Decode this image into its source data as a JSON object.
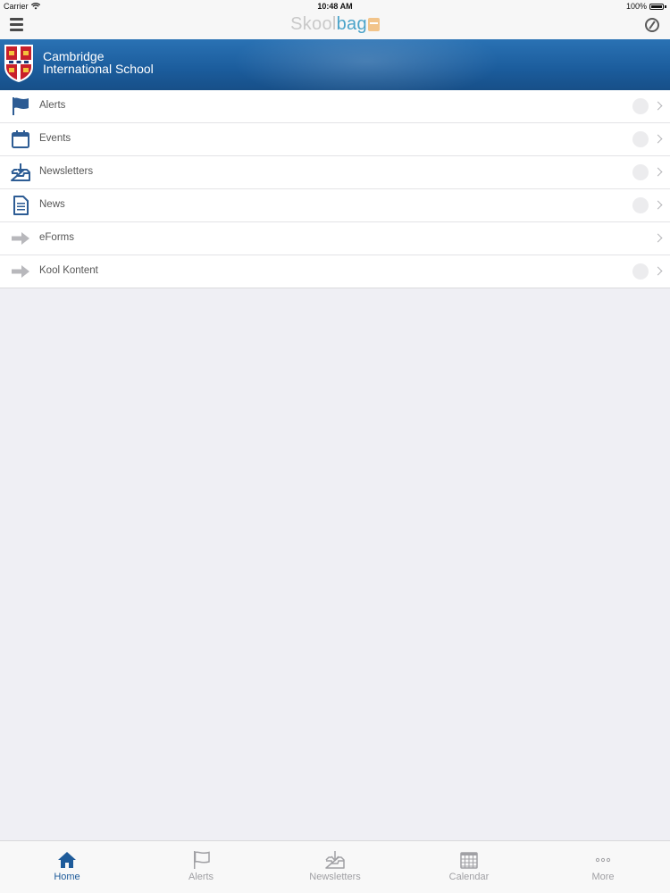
{
  "status_bar": {
    "carrier": "Carrier",
    "time": "10:48 AM",
    "battery": "100%"
  },
  "nav": {
    "logo_part1": "Skool",
    "logo_part2": "bag"
  },
  "school": {
    "name_line1": "Cambridge",
    "name_line2": "International School"
  },
  "menu": [
    {
      "label": "Alerts",
      "icon": "flag-icon",
      "badge": true
    },
    {
      "label": "Events",
      "icon": "calendar-icon",
      "badge": true
    },
    {
      "label": "Newsletters",
      "icon": "inbox-download-icon",
      "badge": true
    },
    {
      "label": "News",
      "icon": "document-icon",
      "badge": true
    },
    {
      "label": "eForms",
      "icon": "arrow-right-icon",
      "badge": false
    },
    {
      "label": "Kool Kontent",
      "icon": "arrow-right-icon",
      "badge": true
    }
  ],
  "tabs": [
    {
      "label": "Home",
      "icon": "home-icon",
      "active": true
    },
    {
      "label": "Alerts",
      "icon": "flag-icon",
      "active": false
    },
    {
      "label": "Newsletters",
      "icon": "inbox-download-icon",
      "active": false
    },
    {
      "label": "Calendar",
      "icon": "calendar-icon",
      "active": false
    },
    {
      "label": "More",
      "icon": "more-icon",
      "active": false
    }
  ],
  "colors": {
    "brand_blue": "#1e5b9a",
    "banner_blue": "#2a72b4",
    "tab_inactive": "#a0a0a4"
  }
}
